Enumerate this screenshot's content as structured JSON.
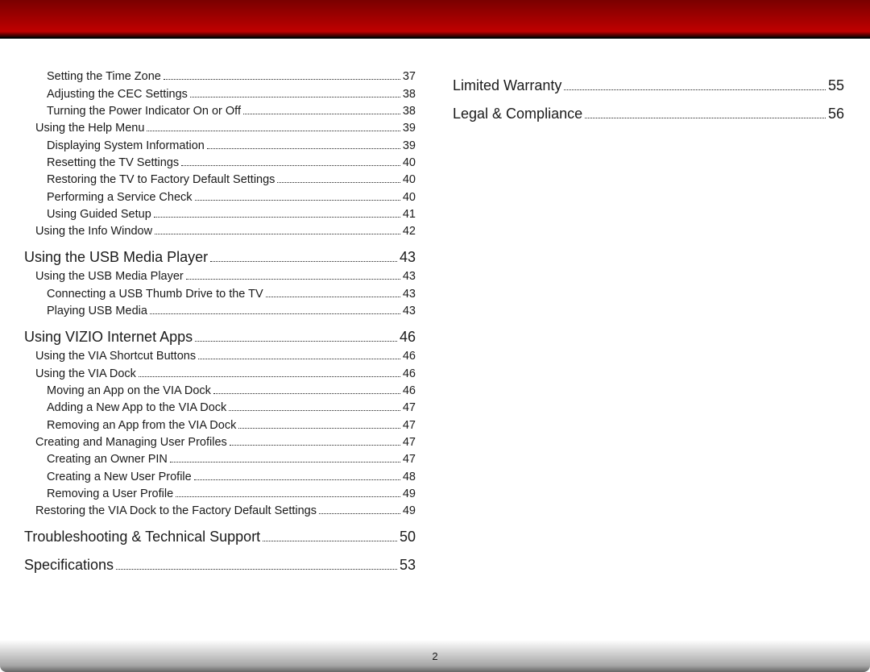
{
  "page_number": "2",
  "columns": [
    [
      {
        "level": 3,
        "title": "Setting the Time Zone",
        "page": "37"
      },
      {
        "level": 3,
        "title": "Adjusting the CEC Settings",
        "page": "38"
      },
      {
        "level": 3,
        "title": "Turning the Power Indicator On or Off",
        "page": "38"
      },
      {
        "level": 2,
        "title": "Using the Help Menu",
        "page": "39"
      },
      {
        "level": 3,
        "title": "Displaying System Information",
        "page": "39"
      },
      {
        "level": 3,
        "title": "Resetting the TV Settings",
        "page": "40"
      },
      {
        "level": 3,
        "title": "Restoring the TV to Factory Default Settings",
        "page": "40"
      },
      {
        "level": 3,
        "title": "Performing a Service Check",
        "page": "40"
      },
      {
        "level": 3,
        "title": "Using Guided Setup",
        "page": "41"
      },
      {
        "level": 2,
        "title": "Using the Info Window",
        "page": "42"
      },
      {
        "level": 1,
        "title": "Using the USB Media Player",
        "page": "43"
      },
      {
        "level": 2,
        "title": "Using the USB Media Player",
        "page": "43"
      },
      {
        "level": 3,
        "title": "Connecting a USB Thumb Drive to the TV",
        "page": "43"
      },
      {
        "level": 3,
        "title": "Playing USB Media",
        "page": "43"
      },
      {
        "level": 1,
        "title": "Using VIZIO Internet Apps",
        "page": "46"
      },
      {
        "level": 2,
        "title": "Using the VIA Shortcut Buttons",
        "page": "46"
      },
      {
        "level": 2,
        "title": "Using the VIA Dock",
        "page": "46"
      },
      {
        "level": 3,
        "title": "Moving an App on the VIA Dock",
        "page": "46"
      },
      {
        "level": 3,
        "title": "Adding a New App to the VIA Dock",
        "page": "47"
      },
      {
        "level": 3,
        "title": "Removing an App from the VIA Dock",
        "page": "47"
      },
      {
        "level": 2,
        "title": "Creating and Managing User Profiles",
        "page": "47"
      },
      {
        "level": 3,
        "title": "Creating an Owner PIN",
        "page": "47"
      },
      {
        "level": 3,
        "title": "Creating a New User Profile",
        "page": "48"
      },
      {
        "level": 3,
        "title": "Removing a User Profile",
        "page": "49"
      },
      {
        "level": 2,
        "title": "Restoring the VIA Dock to the Factory Default Settings",
        "page": "49"
      },
      {
        "level": 1,
        "title": "Troubleshooting & Technical Support",
        "page": "50"
      },
      {
        "level": 1,
        "title": "Specifications",
        "page": "53"
      }
    ],
    [
      {
        "level": 1,
        "title": "Limited Warranty",
        "page": "55"
      },
      {
        "level": 1,
        "title": "Legal & Compliance",
        "page": "56"
      }
    ]
  ]
}
